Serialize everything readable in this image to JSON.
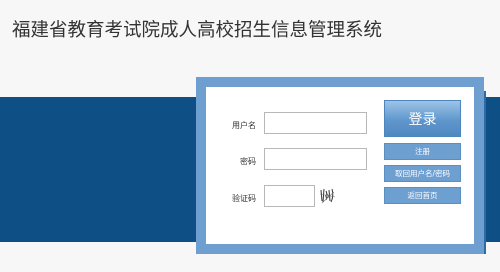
{
  "header": {
    "title": "福建省教育考试院成人高校招生信息管理系统"
  },
  "login": {
    "username_label": "用户名",
    "password_label": "密码",
    "captcha_label": "验证码",
    "username_value": "",
    "password_value": "",
    "captcha_value": "",
    "login_button": "登录",
    "register_button": "注册",
    "recover_button": "取回用户名/密码",
    "home_button": "返回首页"
  },
  "colors": {
    "band": "#0e4f85",
    "panel_frame": "#6f9fd0",
    "button": "#6e9fd1"
  }
}
